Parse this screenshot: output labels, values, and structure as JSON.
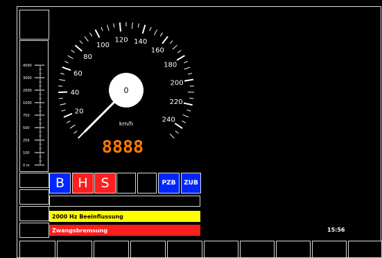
{
  "colors": {
    "background": "#000000",
    "frame": "#dcdcdc",
    "needle": "#ffffff",
    "digital_speed": "#ff7a00",
    "blue": "#0026ff",
    "red": "#ff1e1e",
    "yellow": "#ffff00"
  },
  "speedometer": {
    "current_speed": 0,
    "max_speed": 250,
    "unit": "km/h",
    "hub_value": "0",
    "digital_value": "8888",
    "scale_labels": [
      "20",
      "40",
      "60",
      "80",
      "100",
      "120",
      "140",
      "160",
      "180",
      "200",
      "220",
      "240"
    ]
  },
  "distance_scale": {
    "labels": [
      "4000",
      "3000",
      "2000",
      "1000",
      "750",
      "500",
      "250",
      "100",
      "0 m"
    ]
  },
  "indicators": {
    "b": "B",
    "h": "H",
    "s": "S",
    "pzb": "PZB",
    "zub": "ZUB"
  },
  "messages": {
    "empty": "",
    "info": "2000 Hz Beeinflussung",
    "alert": "Zwangsbremsung"
  },
  "clock": {
    "time": "15:56"
  }
}
